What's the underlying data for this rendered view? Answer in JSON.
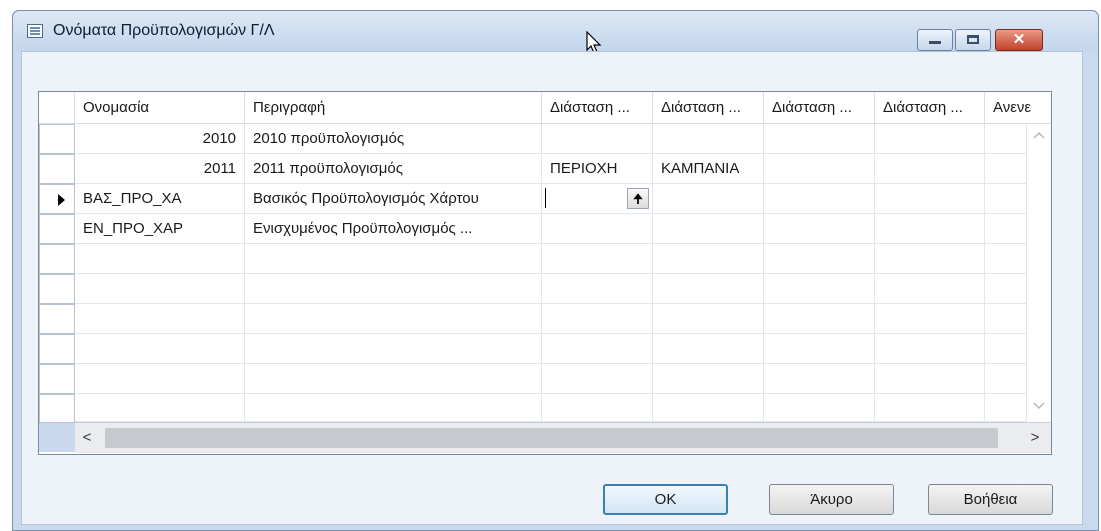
{
  "window": {
    "title": "Ονόματα Προϋπολογισμών Γ/Λ",
    "close_glyph": "✕"
  },
  "grid": {
    "columns": [
      "Ονομασία",
      "Περιγραφή",
      "Διάσταση ...",
      "Διάσταση ...",
      "Διάσταση ...",
      "Διάσταση ...",
      "Ανενε"
    ],
    "rows": [
      {
        "name": "2010",
        "description": "2010 προϋπολογισμός",
        "dim1": "",
        "dim2": "",
        "current": false
      },
      {
        "name": "2011",
        "description": "2011 προϋπολογισμός",
        "dim1": "ΠΕΡΙΟΧΗ",
        "dim2": "ΚΑΜΠΑΝΙΑ",
        "current": false
      },
      {
        "name": "ΒΑΣ_ΠΡΟ_ΧΑ",
        "description": "Βασικός Προϋπολογισμός Χάρτου",
        "dim1": "",
        "dim2": "",
        "current": true
      },
      {
        "name": "ΕΝ_ΠΡΟ_ΧΑΡ",
        "description": "Ενισχυμένος Προϋπολογισμός ...",
        "dim1": "",
        "dim2": "",
        "current": false
      }
    ],
    "assist_glyph": "🠉",
    "scroll_left": "<",
    "scroll_right": ">",
    "scroll_up": "^",
    "scroll_down": "v"
  },
  "buttons": {
    "ok": "OK",
    "cancel": "Άκυρο",
    "help": "Βοήθεια"
  }
}
